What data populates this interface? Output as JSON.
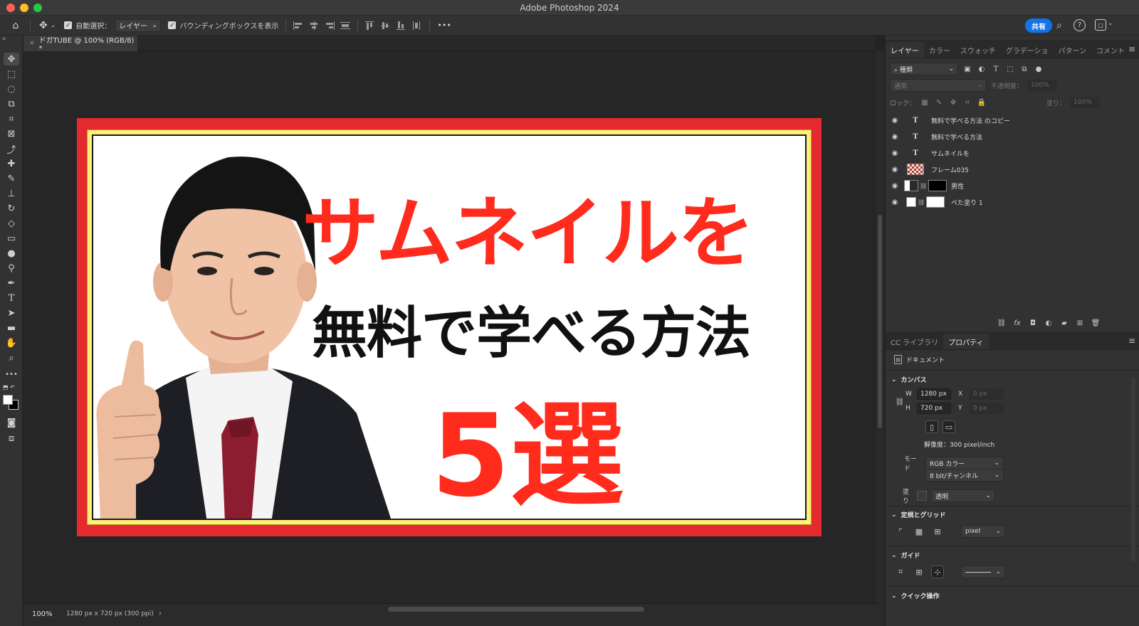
{
  "titlebar": {
    "title": "Adobe Photoshop 2024"
  },
  "options": {
    "auto_select_label": "自動選択：",
    "auto_select_value": "レイヤー",
    "bbox_label": "バウンディングボックスを表示",
    "more": "•••",
    "share_label": "共有"
  },
  "document": {
    "tab_label": "ドガTUBE @ 100% (RGB/8) *",
    "headline1": "サムネイルを",
    "headline2": "無料で学べる方法",
    "headline3": "5選"
  },
  "status": {
    "zoom": "100%",
    "info": "1280 px x 720 px (300 ppi)"
  },
  "layers_panel": {
    "tabs": [
      "レイヤー",
      "カラー",
      "スウォッチ",
      "グラデーショ",
      "パターン",
      "コメント"
    ],
    "filter_label": "種類",
    "blend_mode": "通常",
    "opacity_label": "不透明度：",
    "opacity_value": "100%",
    "lock_label": "ロック：",
    "fill_label": "塗り：",
    "fill_value": "100%",
    "layers": [
      {
        "name": "無料で学べる方法 のコピー",
        "kind": "text"
      },
      {
        "name": "無料で学べる方法",
        "kind": "text"
      },
      {
        "name": "サムネイルを",
        "kind": "text"
      },
      {
        "name": "フレーム035",
        "kind": "image"
      },
      {
        "name": "男性",
        "kind": "masked"
      },
      {
        "name": "べた塗り 1",
        "kind": "fill"
      }
    ]
  },
  "properties_panel": {
    "tabs": [
      "CC ライブラリ",
      "プロパティ"
    ],
    "doc_label": "ドキュメント",
    "canvas_title": "カンバス",
    "w_label": "W",
    "w_value": "1280 px",
    "h_label": "H",
    "h_value": "720 px",
    "x_label": "X",
    "x_placeholder": "0 px",
    "y_label": "Y",
    "y_placeholder": "0 px",
    "resolution": "解像度：300 pixel/inch",
    "mode_label": "モード",
    "mode_value": "RGB カラー",
    "depth_value": "8 bit/チャンネル",
    "fill_label": "塗り",
    "fill_value": "透明",
    "rulers_title": "定規とグリッド",
    "units_value": "pixel",
    "guides_title": "ガイド",
    "quick_actions_title": "クイック操作"
  },
  "colors": {
    "accent": "#1473e6",
    "thumb_red": "#ff2b1d",
    "frame_red": "#e42a2f"
  }
}
